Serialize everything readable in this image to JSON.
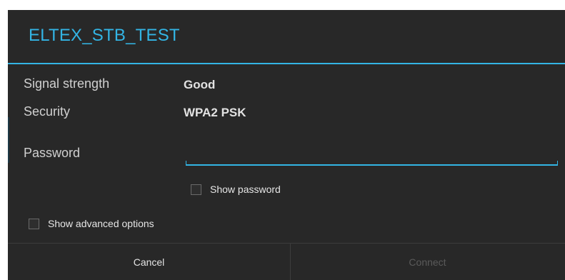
{
  "dialog": {
    "title": "ELTEX_STB_TEST",
    "accent_color": "#33b5e5",
    "background_color": "#282828"
  },
  "info": {
    "signal_label": "Signal strength",
    "signal_value": "Good",
    "security_label": "Security",
    "security_value": "WPA2 PSK"
  },
  "password": {
    "label": "Password",
    "value": "",
    "placeholder": ""
  },
  "options": {
    "show_password_label": "Show password",
    "show_password_checked": false,
    "show_advanced_label": "Show advanced options",
    "show_advanced_checked": false
  },
  "buttons": {
    "cancel_label": "Cancel",
    "connect_label": "Connect",
    "connect_enabled": false
  }
}
